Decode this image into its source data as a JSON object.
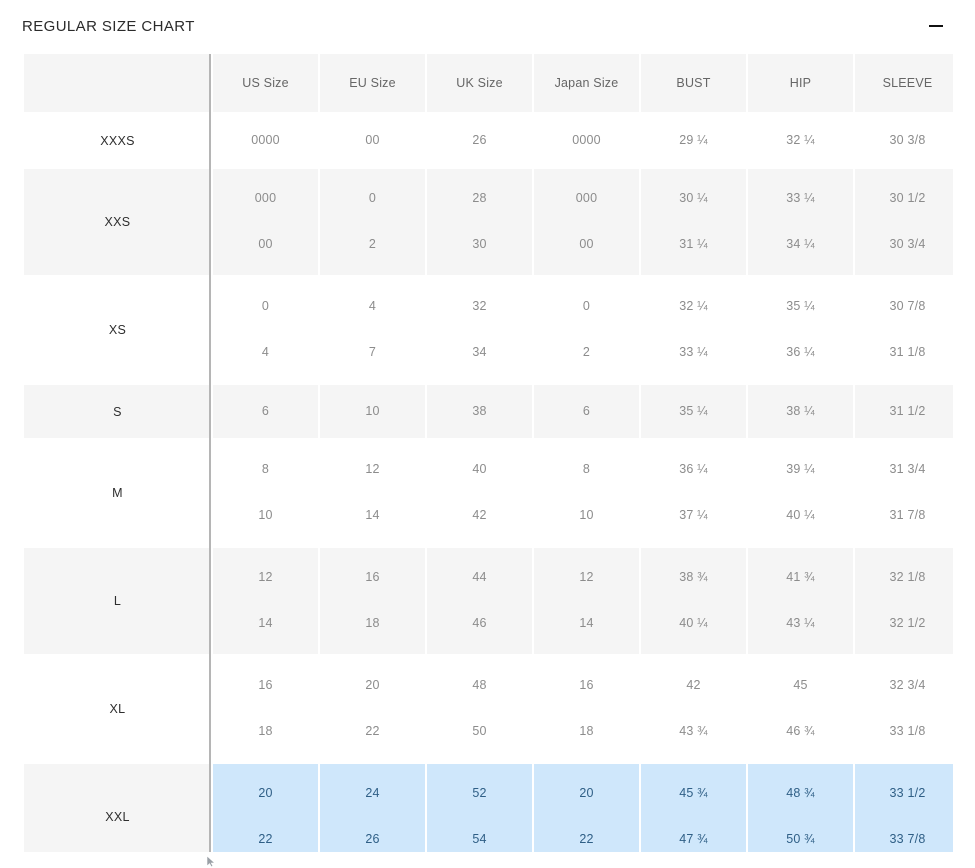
{
  "header": {
    "title": "REGULAR SIZE CHART",
    "collapse_icon": "minus-icon"
  },
  "table": {
    "label_column_header": "",
    "columns": [
      "US Size",
      "EU Size",
      "UK Size",
      "Japan Size",
      "BUST",
      "HIP",
      "SLEEVE"
    ],
    "rows": [
      {
        "label": "XXXS",
        "shaded": false,
        "highlighted": false,
        "values": [
          [
            "0000"
          ],
          [
            "00"
          ],
          [
            "26"
          ],
          [
            "0000"
          ],
          [
            "29 ¼"
          ],
          [
            "32 ¼"
          ],
          [
            "30 3/8"
          ]
        ]
      },
      {
        "label": "XXS",
        "shaded": true,
        "highlighted": false,
        "values": [
          [
            "000",
            "00"
          ],
          [
            "0",
            "2"
          ],
          [
            "28",
            "30"
          ],
          [
            "000",
            "00"
          ],
          [
            "30 ¼",
            "31 ¼"
          ],
          [
            "33 ¼",
            "34 ¼"
          ],
          [
            "30 1/2",
            "30 3/4"
          ]
        ]
      },
      {
        "label": "XS",
        "shaded": false,
        "highlighted": false,
        "values": [
          [
            "0",
            "4"
          ],
          [
            "4",
            "7"
          ],
          [
            "32",
            "34"
          ],
          [
            "0",
            "2"
          ],
          [
            "32 ¼",
            "33 ¼"
          ],
          [
            "35 ¼",
            "36 ¼"
          ],
          [
            "30 7/8",
            "31 1/8"
          ]
        ]
      },
      {
        "label": "S",
        "shaded": true,
        "highlighted": false,
        "values": [
          [
            "6"
          ],
          [
            "10"
          ],
          [
            "38"
          ],
          [
            "6"
          ],
          [
            "35 ¼"
          ],
          [
            "38 ¼"
          ],
          [
            "31 1/2"
          ]
        ]
      },
      {
        "label": "M",
        "shaded": false,
        "highlighted": false,
        "values": [
          [
            "8",
            "10"
          ],
          [
            "12",
            "14"
          ],
          [
            "40",
            "42"
          ],
          [
            "8",
            "10"
          ],
          [
            "36 ¼",
            "37 ¼"
          ],
          [
            "39 ¼",
            "40 ¼"
          ],
          [
            "31 3/4",
            "31 7/8"
          ]
        ]
      },
      {
        "label": "L",
        "shaded": true,
        "highlighted": false,
        "values": [
          [
            "12",
            "14"
          ],
          [
            "16",
            "18"
          ],
          [
            "44",
            "46"
          ],
          [
            "12",
            "14"
          ],
          [
            "38 ¾",
            "40 ¼"
          ],
          [
            "41 ¾",
            "43 ¼"
          ],
          [
            "32 1/8",
            "32 1/2"
          ]
        ]
      },
      {
        "label": "XL",
        "shaded": false,
        "highlighted": false,
        "values": [
          [
            "16",
            "18"
          ],
          [
            "20",
            "22"
          ],
          [
            "48",
            "50"
          ],
          [
            "16",
            "18"
          ],
          [
            "42",
            "43 ¾"
          ],
          [
            "45",
            "46 ¾"
          ],
          [
            "32 3/4",
            "33 1/8"
          ]
        ]
      },
      {
        "label": "XXL",
        "shaded": true,
        "highlighted": true,
        "values": [
          [
            "20",
            "22"
          ],
          [
            "24",
            "26"
          ],
          [
            "52",
            "54"
          ],
          [
            "20",
            "22"
          ],
          [
            "45 ¾",
            "47 ¾"
          ],
          [
            "48 ¾",
            "50 ¾"
          ],
          [
            "33 1/2",
            "33 7/8"
          ]
        ]
      }
    ]
  },
  "colors": {
    "highlight": "#cfe7fb",
    "highlight_text": "#2f5f86",
    "row_shade": "#f5f5f5",
    "row_plain": "#ffffff",
    "data_text": "#8c8c8c",
    "label_text": "#2e2e2e",
    "header_text": "#666666",
    "divider": "#b5b5b5"
  }
}
